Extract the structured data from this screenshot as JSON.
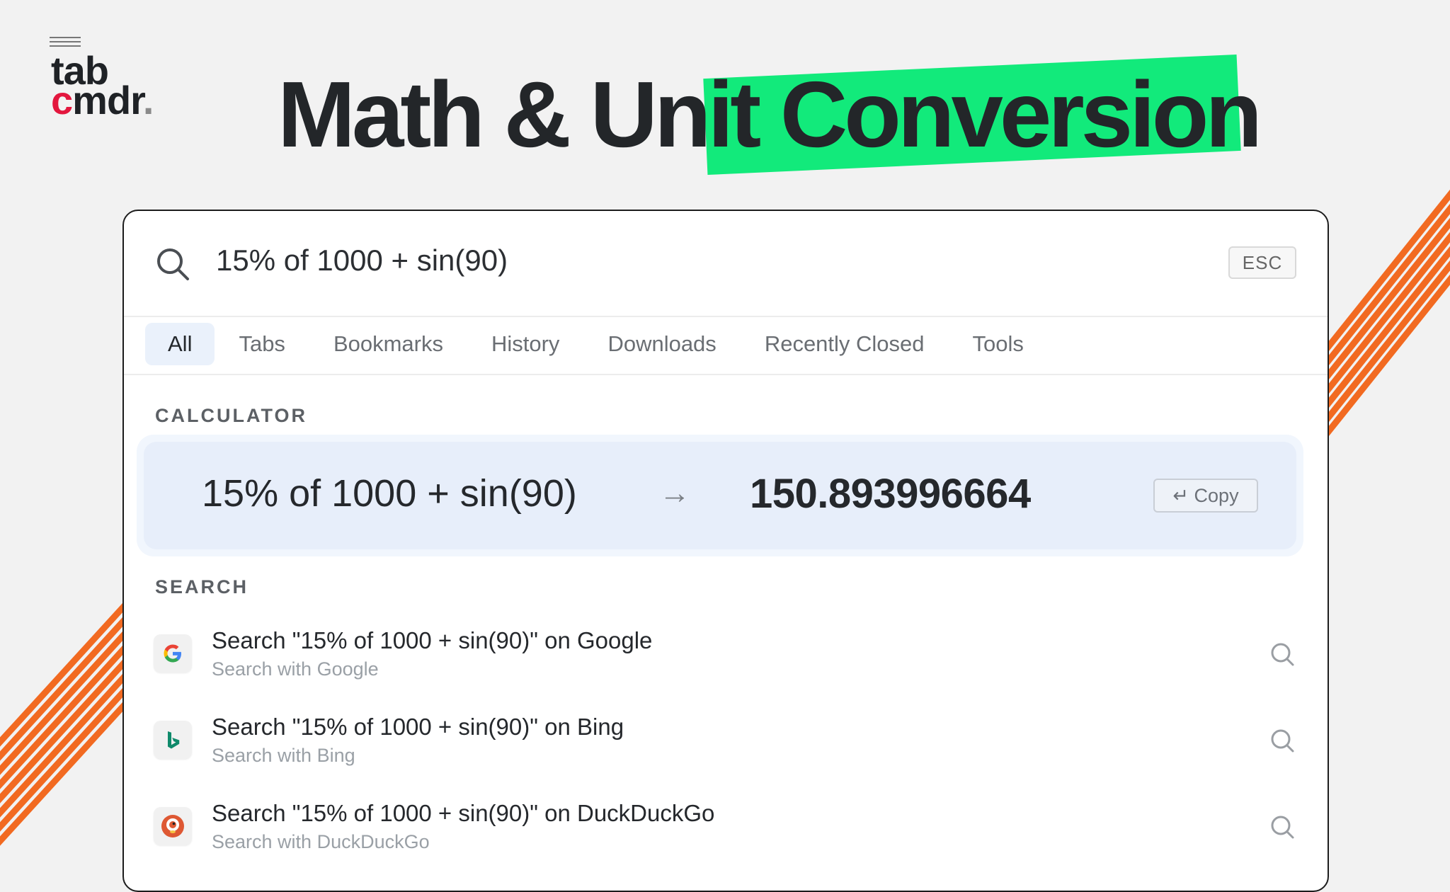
{
  "logo": {
    "line1": "tab",
    "line2_red": "c",
    "line2_rest": "mdr",
    "dot": "."
  },
  "headline": "Math & Unit Conversion",
  "search": {
    "query": "15% of 1000 + sin(90)",
    "esc_label": "ESC"
  },
  "tabs": [
    {
      "label": "All",
      "active": true
    },
    {
      "label": "Tabs"
    },
    {
      "label": "Bookmarks"
    },
    {
      "label": "History"
    },
    {
      "label": "Downloads"
    },
    {
      "label": "Recently Closed"
    },
    {
      "label": "Tools"
    }
  ],
  "calculator": {
    "section_label": "CALCULATOR",
    "expression": "15% of 1000 + sin(90)",
    "arrow": "→",
    "result": "150.893996664",
    "copy_label": "↵ Copy"
  },
  "search_section": {
    "section_label": "SEARCH",
    "results": [
      {
        "title": "Search \"15% of 1000 + sin(90)\" on Google",
        "subtitle": "Search with Google",
        "icon": "google-icon"
      },
      {
        "title": "Search \"15% of 1000 + sin(90)\" on Bing",
        "subtitle": "Search with Bing",
        "icon": "bing-icon"
      },
      {
        "title": "Search \"15% of 1000 + sin(90)\" on DuckDuckGo",
        "subtitle": "Search with DuckDuckGo",
        "icon": "duckduckgo-icon"
      }
    ]
  },
  "colors": {
    "accent_green": "#12ea7b",
    "brand_red": "#e3173e",
    "stripe_orange": "#f26a21",
    "highlight_blue": "#e7eefa"
  }
}
